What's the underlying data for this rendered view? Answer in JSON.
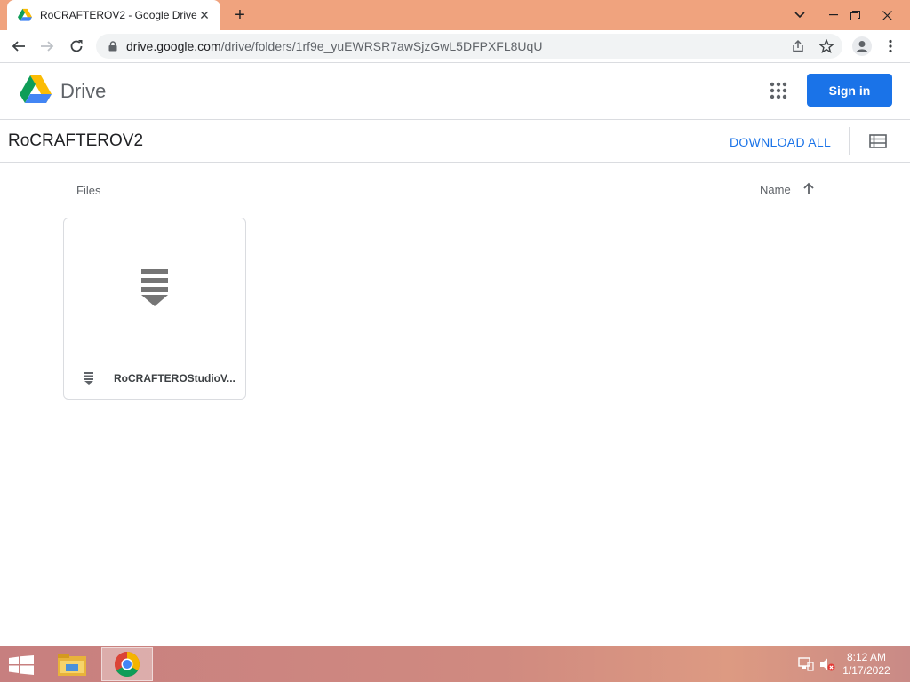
{
  "browser": {
    "tab_title": "RoCRAFTEROV2 - Google Drive",
    "url_host": "drive.google.com",
    "url_path": "/drive/folders/1rf9e_yuEWRSR7awSjzGwL5DFPXFL8UqU"
  },
  "drive": {
    "brand": "Drive",
    "signin_label": "Sign in",
    "folder_title": "RoCRAFTEROV2",
    "download_all_label": "DOWNLOAD ALL",
    "files_section_label": "Files",
    "sort_label": "Name",
    "files": [
      {
        "name": "RoCRAFTEROStudioV..."
      }
    ]
  },
  "taskbar": {
    "time": "8:12 AM",
    "date": "1/17/2022"
  },
  "colors": {
    "accent": "#1a73e8",
    "tabstrip": "#f0a37e",
    "taskbar": "#c77f7f"
  }
}
